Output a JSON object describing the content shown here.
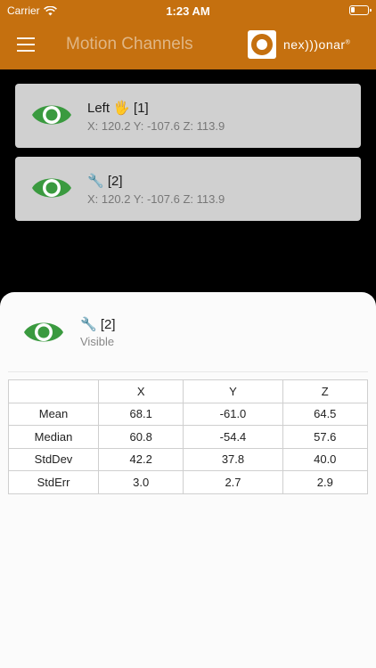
{
  "status_bar": {
    "carrier": "Carrier",
    "time": "1:23 AM"
  },
  "header": {
    "title": "Motion Channels",
    "logo_text": "nex)))onar",
    "logo_mark": "®"
  },
  "channels": [
    {
      "title": "Left 🖐 [1]",
      "coords": "X: 120.2 Y: -107.6 Z: 113.9",
      "icon": "eye-icon"
    },
    {
      "title": "🔧 [2]",
      "coords": "X: 120.2 Y: -107.6 Z: 113.9",
      "icon": "eye-icon"
    }
  ],
  "detail": {
    "title": "🔧 [2]",
    "status": "Visible",
    "table": {
      "headers": [
        "",
        "X",
        "Y",
        "Z"
      ],
      "rows": [
        {
          "label": "Mean",
          "x": "68.1",
          "y": "-61.0",
          "z": "64.5"
        },
        {
          "label": "Median",
          "x": "60.8",
          "y": "-54.4",
          "z": "57.6"
        },
        {
          "label": "StdDev",
          "x": "42.2",
          "y": "37.8",
          "z": "40.0"
        },
        {
          "label": "StdErr",
          "x": "3.0",
          "y": "2.7",
          "z": "2.9"
        }
      ]
    }
  },
  "colors": {
    "accent": "#c5700f",
    "eye": "#3a9a3f",
    "card": "#d0d0d0"
  }
}
